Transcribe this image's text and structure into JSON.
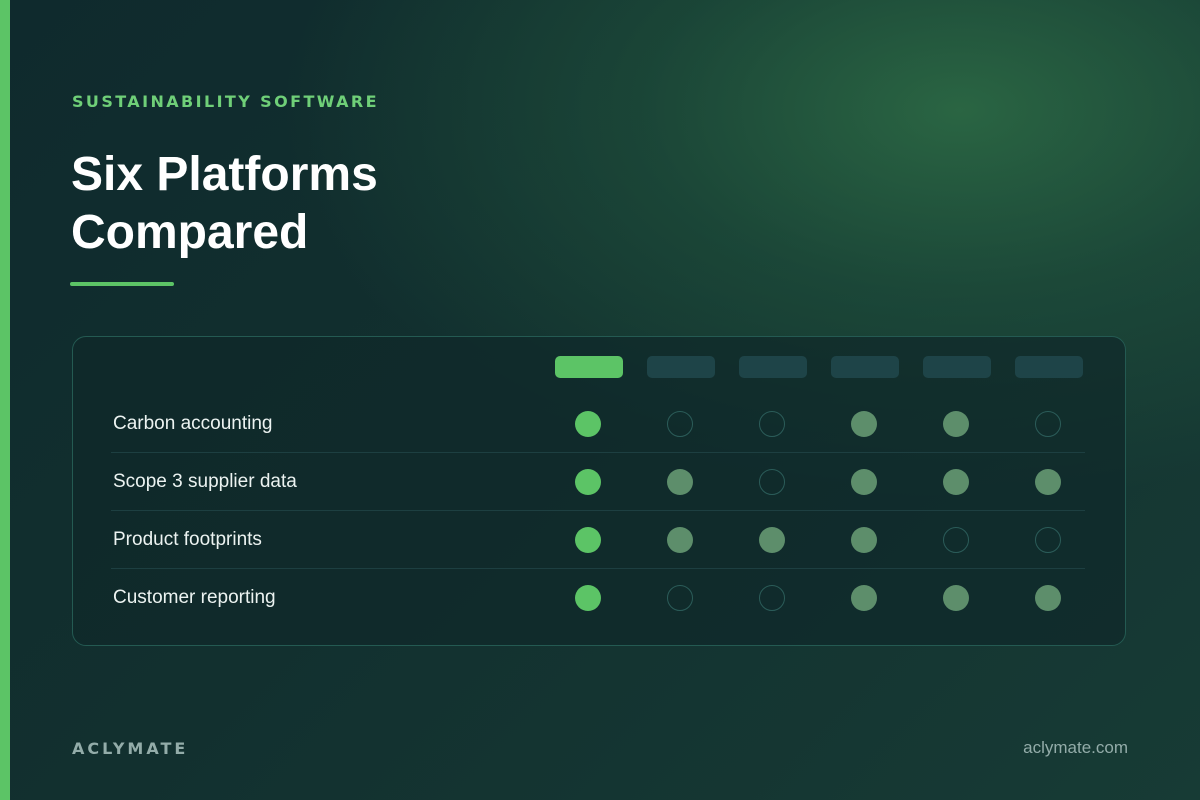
{
  "eyebrow": "SUSTAINABILITY SOFTWARE",
  "title": {
    "line1": "Six Platforms",
    "line2": "Compared"
  },
  "comparison": {
    "columns": 6,
    "featured_column": 0,
    "rows": [
      {
        "label": "Carbon accounting",
        "values": [
          "primary",
          "empty",
          "empty",
          "filled",
          "filled",
          "empty"
        ]
      },
      {
        "label": "Scope 3 supplier data",
        "values": [
          "primary",
          "filled",
          "empty",
          "filled",
          "filled",
          "filled"
        ]
      },
      {
        "label": "Product footprints",
        "values": [
          "primary",
          "filled",
          "filled",
          "filled",
          "empty",
          "empty"
        ]
      },
      {
        "label": "Customer reporting",
        "values": [
          "primary",
          "empty",
          "empty",
          "filled",
          "filled",
          "filled"
        ]
      }
    ]
  },
  "footer": {
    "brand": "ACLYMATE",
    "site": "aclymate.com"
  },
  "colors": {
    "accent": "#5cc466",
    "filled_dot": "#5d8e6b",
    "empty_dot_outline": "#2b5c59",
    "column_header": "#1e4448",
    "background": "#112a2c"
  }
}
